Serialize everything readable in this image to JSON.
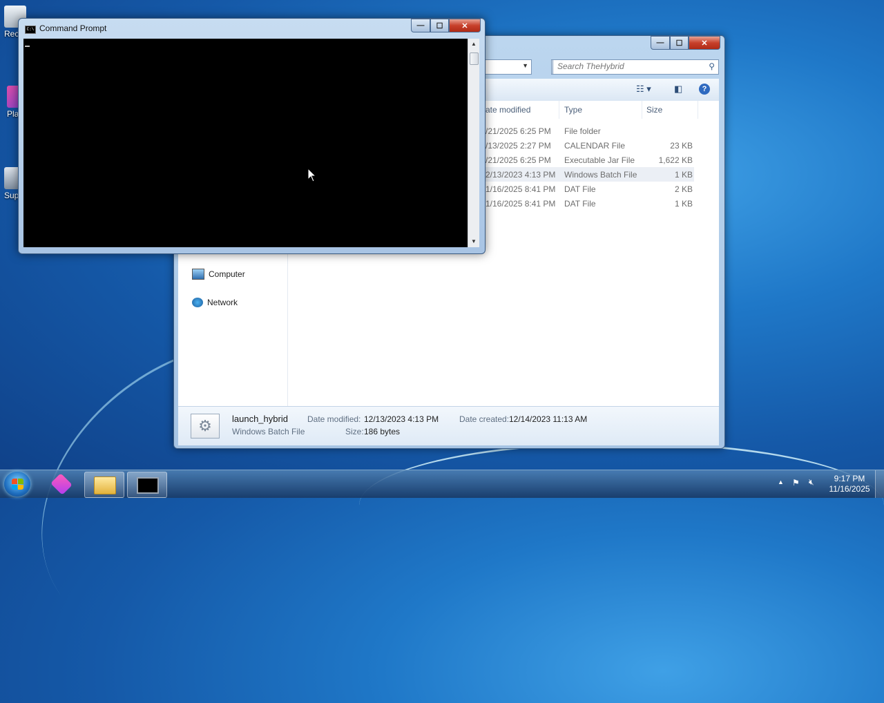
{
  "desktop": {
    "icons": [
      {
        "label": "Rec",
        "icon": "recycle-bin-icon"
      },
      {
        "label": "Pla",
        "icon": "app-icon"
      },
      {
        "label": "Sup",
        "icon": "support-icon"
      }
    ]
  },
  "explorer": {
    "search_placeholder": "Search TheHybrid",
    "columns": [
      "ate modified",
      "Type",
      "Size"
    ],
    "files": [
      {
        "date": "/21/2025 6:25 PM",
        "type": "File folder",
        "size": ""
      },
      {
        "date": "/13/2025 2:27 PM",
        "type": "CALENDAR File",
        "size": "23 KB"
      },
      {
        "date": "/21/2025 6:25 PM",
        "type": "Executable Jar File",
        "size": "1,622 KB"
      },
      {
        "date": "2/13/2023 4:13 PM",
        "type": "Windows Batch File",
        "size": "1 KB"
      },
      {
        "date": "1/16/2025 8:41 PM",
        "type": "DAT File",
        "size": "2 KB"
      },
      {
        "date": "1/16/2025 8:41 PM",
        "type": "DAT File",
        "size": "1 KB"
      }
    ],
    "nav": {
      "computer": "Computer",
      "network": "Network"
    },
    "details": {
      "name": "launch_hybrid",
      "type": "Windows Batch File",
      "date_modified_label": "Date modified:",
      "date_modified": "12/13/2023 4:13 PM",
      "date_created_label": "Date created:",
      "date_created": "12/14/2023 11:13 AM",
      "size_label": "Size:",
      "size": "186 bytes"
    }
  },
  "cmd": {
    "title": "Command Prompt"
  },
  "window_buttons": {
    "minimize": "—",
    "maximize": "☐",
    "close": "✕"
  },
  "taskbar": {
    "time": "9:17 PM",
    "date": "11/16/2025"
  },
  "colors": {
    "selected_row": "#ebeff5",
    "console_bg": "#000000"
  }
}
